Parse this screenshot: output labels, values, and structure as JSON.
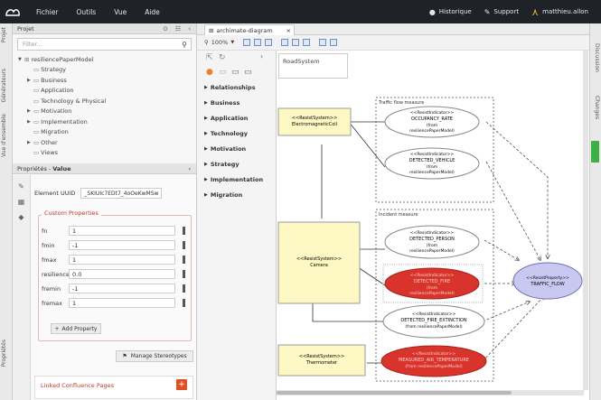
{
  "menu": [
    "Fichier",
    "Outils",
    "Vue",
    "Aide"
  ],
  "topright": {
    "history": "Historique",
    "support": "Support",
    "user": "matthieu.allon"
  },
  "left_tabs": [
    "Projet",
    "Générateurs",
    "Vue d'ensemble",
    "Propriétés"
  ],
  "right_tabs": [
    "Discussion",
    "Changes"
  ],
  "project": {
    "title": "Projet",
    "filter_placeholder": "Filter...",
    "tree": [
      {
        "label": "resiliencePaperModel",
        "level": 0,
        "expanded": true
      },
      {
        "label": "Strategy",
        "level": 1
      },
      {
        "label": "Business",
        "level": 1
      },
      {
        "label": "Application",
        "level": 1
      },
      {
        "label": "Technology & Physical",
        "level": 1
      },
      {
        "label": "Motivation",
        "level": 1
      },
      {
        "label": "Implementation",
        "level": 1
      },
      {
        "label": "Migration",
        "level": 1
      },
      {
        "label": "Other",
        "level": 1
      },
      {
        "label": "Views",
        "level": 1
      }
    ]
  },
  "properties": {
    "title": "Propriétés",
    "subtitle": "Value",
    "uuid_label": "Element UUID",
    "uuid_value": "_SKIUIc7EDt7_4oOeKwMSw",
    "custom_title": "Custom Properties",
    "rows": [
      {
        "key": "fn",
        "value": "1"
      },
      {
        "key": "fmin",
        "value": "-1"
      },
      {
        "key": "fmax",
        "value": "1"
      },
      {
        "key": "resilience",
        "value": "0.0"
      },
      {
        "key": "fremin",
        "value": "-1"
      },
      {
        "key": "fremax",
        "value": "1"
      }
    ],
    "add_property": "Add Property",
    "manage_stereotypes": "Manage Stereotypes",
    "confluence": "Linked Confluence Pages"
  },
  "editor_tab": "archimate-diagram",
  "zoom": "100%",
  "palette": [
    "Relationships",
    "Business",
    "Application",
    "Technology",
    "Motivation",
    "Strategy",
    "Implementation",
    "Migration"
  ],
  "canvas": {
    "road_label": "RoadSystem",
    "group1": "Traffic flow measure",
    "group2": "Incident measure",
    "sys1": {
      "stereo": "<<ResistSystem>>",
      "name": "ElectromagneticCoil"
    },
    "sys2": {
      "stereo": "<<ResistSystem>>",
      "name": "Camera"
    },
    "sys3": {
      "stereo": "<<ResistSystem>>",
      "name": "Thermometer"
    },
    "ind1": {
      "stereo": "<<ResistIndicator>>",
      "name": "OCCUPANCY_RATE",
      "from": "(from",
      "model": "resiliencePaperModel)"
    },
    "ind2": {
      "stereo": "<<ResistIndicator>>",
      "name": "DETECTED_VEHICLE",
      "from": "(from",
      "model": "resiliencePaperModel)"
    },
    "ind3": {
      "stereo": "<<ResistIndicator>>",
      "name": "DETECTED_PERSON",
      "from": "(from",
      "model": "resiliencePaperModel)"
    },
    "ind4": {
      "stereo": "<<ResistIndicator>>",
      "name": "DETECTED_FIRE",
      "from": "(from",
      "model": "resiliencePaperModel)"
    },
    "ind5": {
      "stereo": "<<ResistIndicator>>",
      "name": "DETECTED_FIRE_EXTINCTION",
      "from": "(from resiliencePaperModel)"
    },
    "ind6": {
      "stereo": "<<ResistIndicator>>",
      "name": "MEASURED_AIR_TEMPERATURE",
      "from": "(from resiliencePaperModel)"
    },
    "prop": {
      "stereo": "<<ResistProperty>>",
      "name": "TRAFFIC_FLOW"
    }
  },
  "colors": {
    "topbar": "#1f2328",
    "accent": "#e04e25",
    "system_fill": "#fdf8c4",
    "red_indicator": "#d9342b",
    "property_fill": "#c8c8f0"
  }
}
